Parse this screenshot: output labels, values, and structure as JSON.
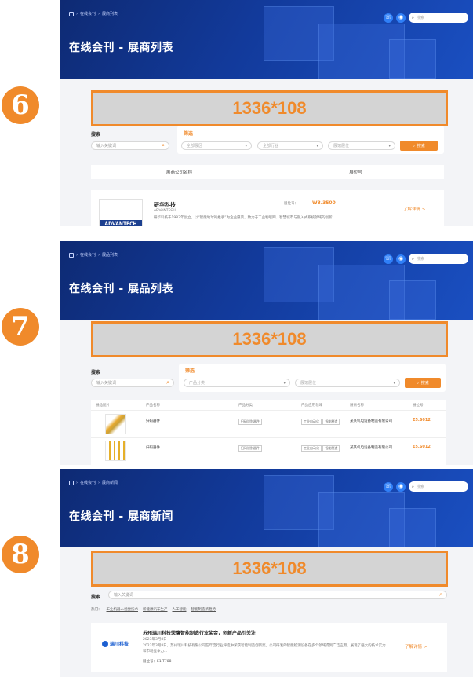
{
  "colors": {
    "accent": "#f08a2b",
    "hero": "#123a9b",
    "banner_bg": "#d4d4d4"
  },
  "panel6": {
    "number": "6",
    "crumb": [
      "在线会刊",
      "展商列表"
    ],
    "title": "在线会刊 - 展商列表",
    "hero_search_placeholder": "搜索",
    "banner": "1336*108",
    "search_label": "搜索",
    "search_placeholder": "输入关键词",
    "filter_label": "筛选",
    "filters": [
      "全部展区",
      "全部行业",
      "展馆展位"
    ],
    "search_button": "搜索",
    "tabs": [
      "展商公司名称",
      "展位号"
    ],
    "company": "研华科技",
    "company_en": "ADVANTECH",
    "logo": "ADVANTECH",
    "booth_prefix": "展位号：",
    "booth": "W3.3500",
    "learn_more": "了解详情 >",
    "desc": "研华科技于1983年创立，以“智能地球的推手”为企业愿景，致力于工业物联网、智慧城市与嵌入式系统领域的创新..."
  },
  "panel7": {
    "number": "7",
    "crumb": [
      "在线会刊",
      "展品列表"
    ],
    "title": "在线会刊 - 展品列表",
    "hero_search_placeholder": "搜索",
    "banner": "1336*108",
    "search_label": "搜索",
    "search_placeholder": "输入关键词",
    "filter_label": "筛选",
    "filters": [
      "产品分类",
      "展馆展位"
    ],
    "search_button": "搜索",
    "columns": [
      "展品图片",
      "产品名称",
      "产品分类",
      "产品应用领域",
      "展商名称",
      "展位号"
    ],
    "rows": [
      {
        "name": "扫码器件",
        "category": "扫码识别器件",
        "tags": [
          "工业自动化",
          "智能制造"
        ],
        "exhibitor": "某某机电设备制造有限公司",
        "booth": "E5.S012"
      },
      {
        "name": "扫码器件",
        "category": "扫码识别器件",
        "tags": [
          "工业自动化",
          "智能制造"
        ],
        "exhibitor": "某某机电设备制造有限公司",
        "booth": "E5.S012"
      }
    ]
  },
  "panel8": {
    "number": "8",
    "crumb": [
      "在线会刊",
      "展商新闻"
    ],
    "title": "在线会刊 - 展商新闻",
    "hero_search_placeholder": "搜索",
    "banner": "1336*108",
    "search_label": "搜索",
    "search_placeholder": "输入关键词",
    "hot_label": "热门：",
    "hot_tags": [
      "工业机器人视觉技术",
      "新能源汽车生产",
      "人工智能",
      "智能制造新趋势"
    ],
    "news_title": "苏州瑞川科技荣膺智能制造行业奖金，创新产品引关注",
    "news_date": "2023年3月8日",
    "news_desc": "2023年3月8日，苏州瑞川科技有限公司在年度行业评选中荣获智能制造创新奖。公司研发的智能检测设备在多个领域得到广泛应用，展现了强大的技术实力和市场竞争力...",
    "logo": "瑞川科技",
    "booth_prefix": "展位号：",
    "booth": "E1.T788",
    "learn_more": "了解详情 >"
  }
}
